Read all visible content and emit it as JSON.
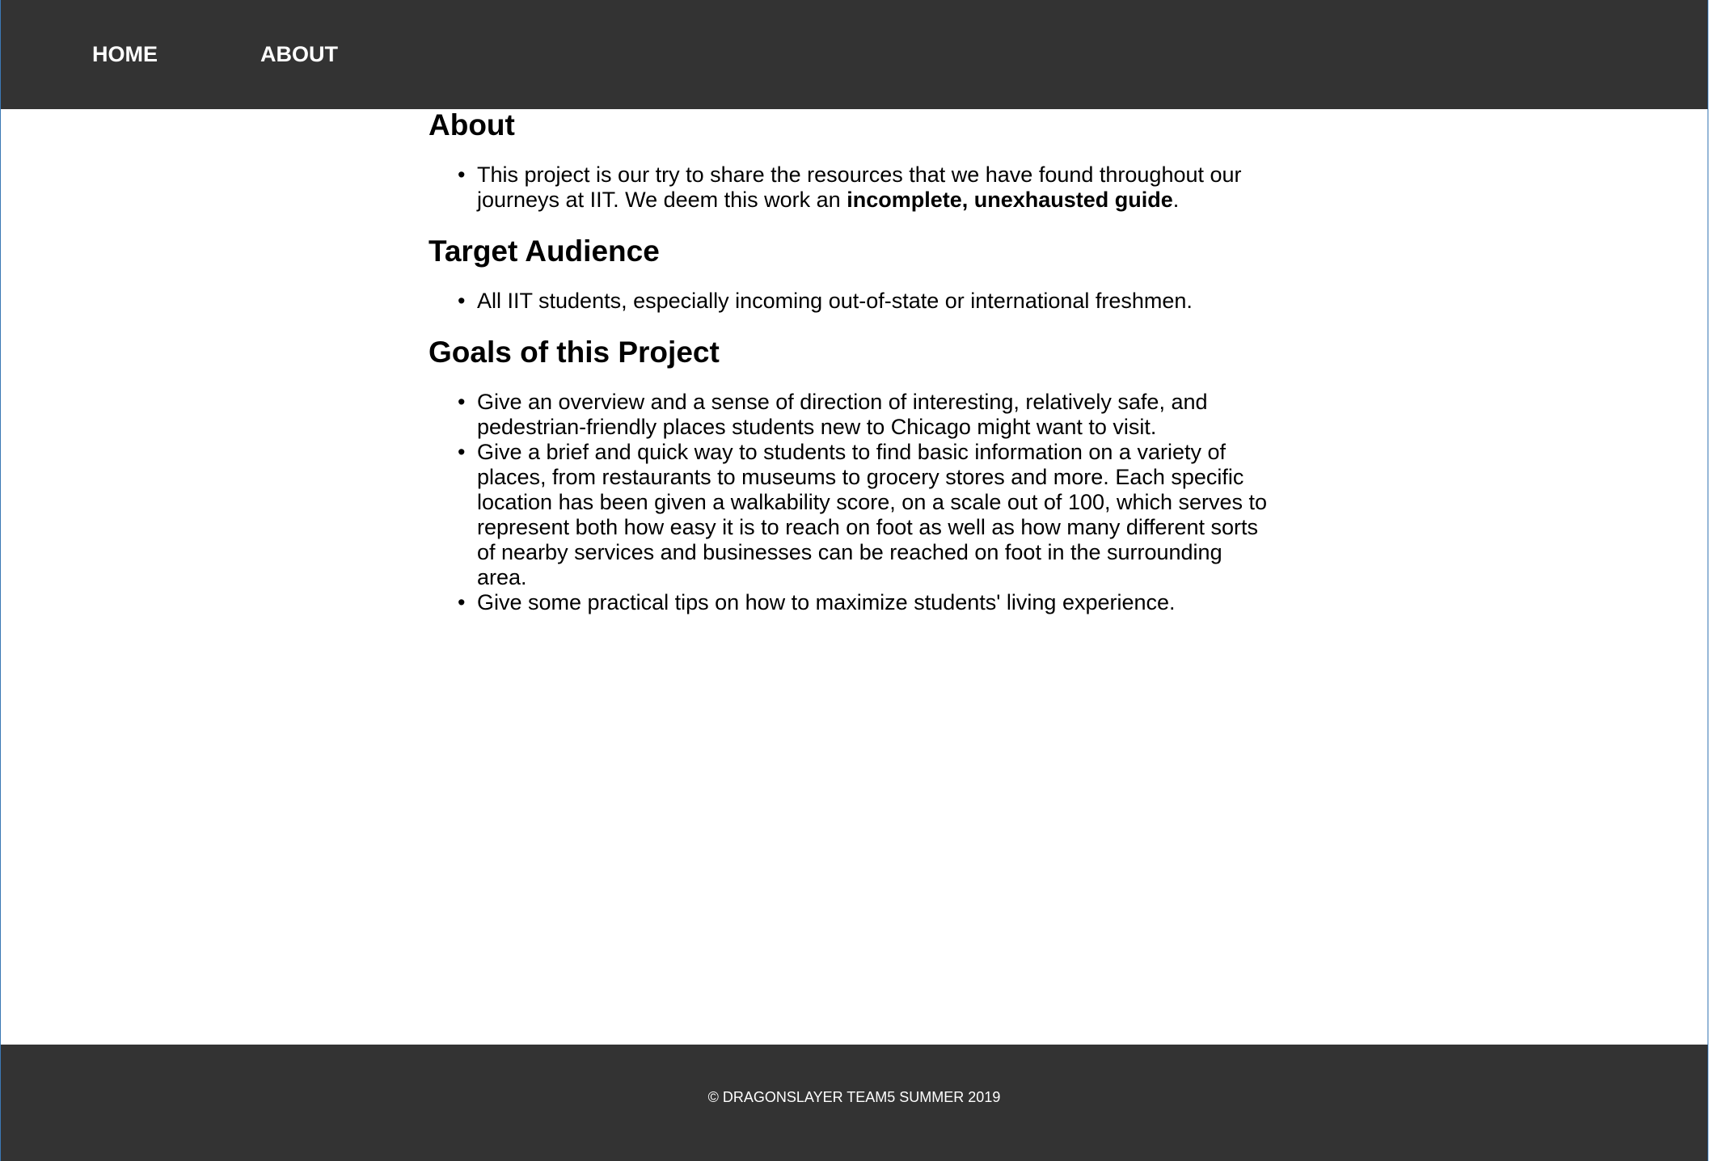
{
  "nav": {
    "home_label": "HOME",
    "about_label": "ABOUT"
  },
  "about": {
    "heading": "About",
    "item_text": "This project is our try to share the resources that we have found throughout our journeys at IIT. We deem this work an ",
    "item_bold": "incomplete, unexhausted guide",
    "item_end": "."
  },
  "target": {
    "heading": "Target Audience",
    "items": [
      "All IIT students, especially incoming out-of-state or international freshmen."
    ]
  },
  "goals": {
    "heading": "Goals of this Project",
    "items": [
      "Give an overview and a sense of direction of interesting, relatively safe, and pedestrian-friendly places students new to Chicago might want to visit.",
      "Give a brief and quick way to students to find basic information on a variety of places, from restaurants to museums to grocery stores and more. Each specific location has been given a walkability score, on a scale out of 100, which serves to represent both how easy it is to reach on foot as well as how many different sorts of nearby services and businesses can be reached on foot in the surrounding area.",
      "Give some practical tips on how to maximize students' living experience."
    ]
  },
  "footer": {
    "text": "© DRAGONSLAYER TEAM5 SUMMER 2019"
  },
  "colors": {
    "bar_background": "#333333",
    "page_background": "#ffffff",
    "text": "#000000",
    "nav_text": "#ffffff",
    "window_border": "#3b79b5"
  }
}
